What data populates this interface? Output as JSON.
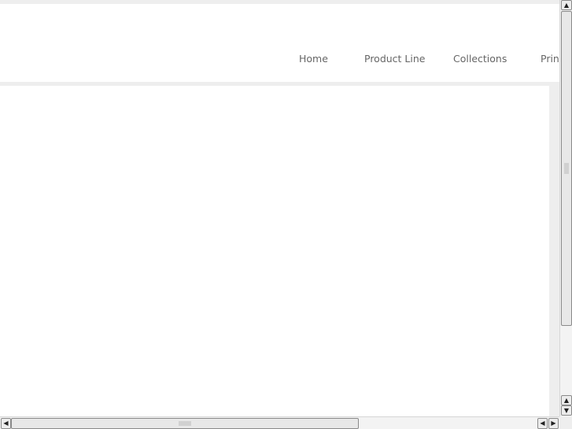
{
  "header": {
    "nav": [
      {
        "label": "Home"
      },
      {
        "label": "Product Line"
      },
      {
        "label": "Collections"
      },
      {
        "label": "Print"
      }
    ]
  },
  "scrollbars": {
    "up_icon": "▲",
    "down_icon": "▼",
    "left_icon": "◀",
    "right_icon": "▶"
  }
}
